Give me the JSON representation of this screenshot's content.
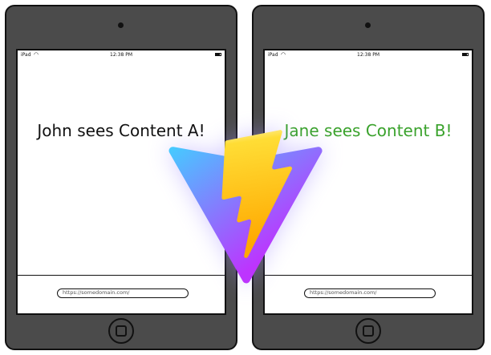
{
  "left_device": {
    "status": {
      "carrier": "iPad",
      "time": "12:38 PM"
    },
    "headline": "John sees Content A!",
    "url": "https://somedomain.com/"
  },
  "right_device": {
    "status": {
      "carrier": "iPad",
      "time": "12:38 PM"
    },
    "headline": "Jane sees Content B!",
    "url": "https://somedomain.com/"
  },
  "colors": {
    "tablet_body": "#4b4b4b",
    "headline_left": "#111111",
    "headline_right": "#3aa22c",
    "logo_gradient_start": "#41d1ff",
    "logo_gradient_end": "#bd34fe",
    "bolt_start": "#ffea83",
    "bolt_end": "#ffa800"
  },
  "icons": {
    "center_logo": "vite-logo",
    "status_wifi": "wifi-icon",
    "status_battery": "battery-icon",
    "home_button": "home-button-icon"
  }
}
